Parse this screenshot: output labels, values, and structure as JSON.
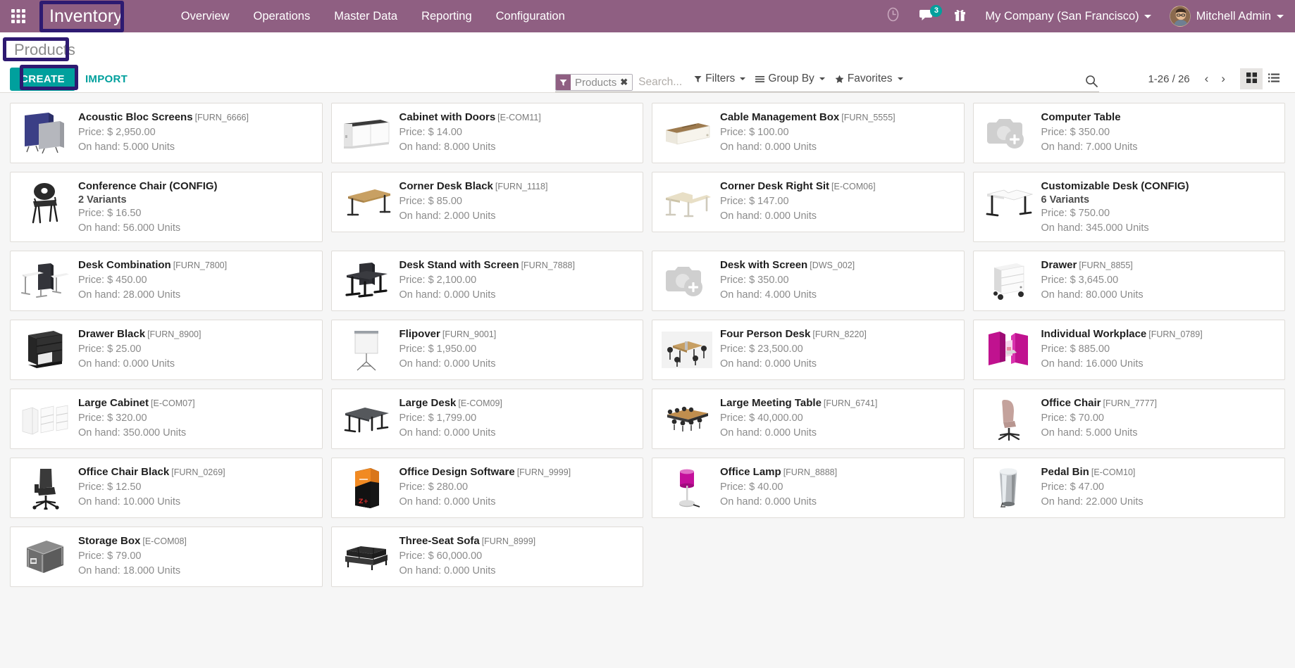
{
  "navbar": {
    "apps_icon": "apps-grid-icon",
    "brand": "Inventory",
    "menu": [
      {
        "label": "Overview"
      },
      {
        "label": "Operations"
      },
      {
        "label": "Master Data"
      },
      {
        "label": "Reporting"
      },
      {
        "label": "Configuration"
      }
    ],
    "activity_icon": "clock-icon",
    "messages_icon": "messages-icon",
    "messages_count": "3",
    "gift_icon": "gift-icon",
    "company": "My Company (San Francisco)",
    "user": "Mitchell Admin"
  },
  "control_panel": {
    "breadcrumb": "Products",
    "create_label": "CREATE",
    "import_label": "IMPORT",
    "filters_label": "Filters",
    "group_by_label": "Group By",
    "favorites_label": "Favorites",
    "pager": "1-26 / 26",
    "prev_icon": "chevron-left-icon",
    "next_icon": "chevron-right-icon",
    "kanban_view_icon": "kanban-view-icon",
    "list_view_icon": "list-view-icon"
  },
  "search": {
    "facet_label": "Products",
    "facet_remove_icon": "close-icon",
    "placeholder": "Search...",
    "value": "",
    "toggle_icon": "search-icon"
  },
  "highlights": {
    "color": "#2e1a71",
    "targets": [
      "brand-inventory",
      "breadcrumb-products",
      "create-button"
    ]
  },
  "colors": {
    "navbar": "#8f5f82",
    "accent": "#00a09d",
    "badge": "#00a09d",
    "highlight": "#2e1a71",
    "page_bg": "#f6f6f6"
  },
  "products": [
    {
      "name": "Acoustic Bloc Screens",
      "code": "[FURN_6666]",
      "variants": "",
      "price": "Price: $ 2,950.00",
      "on_hand": "On hand: 5.000 Units",
      "img": "acoustic-screens"
    },
    {
      "name": "Cabinet with Doors",
      "code": "[E-COM11]",
      "variants": "",
      "price": "Price: $ 14.00",
      "on_hand": "On hand: 8.000 Units",
      "img": "cabinet-doors"
    },
    {
      "name": "Cable Management Box",
      "code": "[FURN_5555]",
      "variants": "",
      "price": "Price: $ 100.00",
      "on_hand": "On hand: 0.000 Units",
      "img": "cable-box"
    },
    {
      "name": "Computer Table",
      "code": "",
      "variants": "",
      "price": "Price: $ 350.00",
      "on_hand": "On hand: 7.000 Units",
      "img": "placeholder"
    },
    {
      "name": "Conference Chair (CONFIG)",
      "code": "",
      "variants": "2 Variants",
      "price": "Price: $ 16.50",
      "on_hand": "On hand: 56.000 Units",
      "img": "conference-chair"
    },
    {
      "name": "Corner Desk Black",
      "code": "[FURN_1118]",
      "variants": "",
      "price": "Price: $ 85.00",
      "on_hand": "On hand: 2.000 Units",
      "img": "corner-desk-black"
    },
    {
      "name": "Corner Desk Right Sit",
      "code": "[E-COM06]",
      "variants": "",
      "price": "Price: $ 147.00",
      "on_hand": "On hand: 0.000 Units",
      "img": "corner-desk-right"
    },
    {
      "name": "Customizable Desk (CONFIG)",
      "code": "",
      "variants": "6 Variants",
      "price": "Price: $ 750.00",
      "on_hand": "On hand: 345.000 Units",
      "img": "customizable-desk"
    },
    {
      "name": "Desk Combination",
      "code": "[FURN_7800]",
      "variants": "",
      "price": "Price: $ 450.00",
      "on_hand": "On hand: 28.000 Units",
      "img": "desk-combination"
    },
    {
      "name": "Desk Stand with Screen",
      "code": "[FURN_7888]",
      "variants": "",
      "price": "Price: $ 2,100.00",
      "on_hand": "On hand: 0.000 Units",
      "img": "desk-stand-screen"
    },
    {
      "name": "Desk with Screen",
      "code": "[DWS_002]",
      "variants": "",
      "price": "Price: $ 350.00",
      "on_hand": "On hand: 4.000 Units",
      "img": "placeholder"
    },
    {
      "name": "Drawer",
      "code": "[FURN_8855]",
      "variants": "",
      "price": "Price: $ 3,645.00",
      "on_hand": "On hand: 80.000 Units",
      "img": "drawer-white"
    },
    {
      "name": "Drawer Black",
      "code": "[FURN_8900]",
      "variants": "",
      "price": "Price: $ 25.00",
      "on_hand": "On hand: 0.000 Units",
      "img": "drawer-black"
    },
    {
      "name": "Flipover",
      "code": "[FURN_9001]",
      "variants": "",
      "price": "Price: $ 1,950.00",
      "on_hand": "On hand: 0.000 Units",
      "img": "flipover"
    },
    {
      "name": "Four Person Desk",
      "code": "[FURN_8220]",
      "variants": "",
      "price": "Price: $ 23,500.00",
      "on_hand": "On hand: 0.000 Units",
      "img": "four-person-desk"
    },
    {
      "name": "Individual Workplace",
      "code": "[FURN_0789]",
      "variants": "",
      "price": "Price: $ 885.00",
      "on_hand": "On hand: 16.000 Units",
      "img": "individual-workplace"
    },
    {
      "name": "Large Cabinet",
      "code": "[E-COM07]",
      "variants": "",
      "price": "Price: $ 320.00",
      "on_hand": "On hand: 350.000 Units",
      "img": "large-cabinet"
    },
    {
      "name": "Large Desk",
      "code": "[E-COM09]",
      "variants": "",
      "price": "Price: $ 1,799.00",
      "on_hand": "On hand: 0.000 Units",
      "img": "large-desk"
    },
    {
      "name": "Large Meeting Table",
      "code": "[FURN_6741]",
      "variants": "",
      "price": "Price: $ 40,000.00",
      "on_hand": "On hand: 0.000 Units",
      "img": "meeting-table"
    },
    {
      "name": "Office Chair",
      "code": "[FURN_7777]",
      "variants": "",
      "price": "Price: $ 70.00",
      "on_hand": "On hand: 5.000 Units",
      "img": "office-chair-pink"
    },
    {
      "name": "Office Chair Black",
      "code": "[FURN_0269]",
      "variants": "",
      "price": "Price: $ 12.50",
      "on_hand": "On hand: 10.000 Units",
      "img": "office-chair-black"
    },
    {
      "name": "Office Design Software",
      "code": "[FURN_9999]",
      "variants": "",
      "price": "Price: $ 280.00",
      "on_hand": "On hand: 0.000 Units",
      "img": "software-box"
    },
    {
      "name": "Office Lamp",
      "code": "[FURN_8888]",
      "variants": "",
      "price": "Price: $ 40.00",
      "on_hand": "On hand: 0.000 Units",
      "img": "office-lamp"
    },
    {
      "name": "Pedal Bin",
      "code": "[E-COM10]",
      "variants": "",
      "price": "Price: $ 47.00",
      "on_hand": "On hand: 22.000 Units",
      "img": "pedal-bin"
    },
    {
      "name": "Storage Box",
      "code": "[E-COM08]",
      "variants": "",
      "price": "Price: $ 79.00",
      "on_hand": "On hand: 18.000 Units",
      "img": "storage-box"
    },
    {
      "name": "Three-Seat Sofa",
      "code": "[FURN_8999]",
      "variants": "",
      "price": "Price: $ 60,000.00",
      "on_hand": "On hand: 0.000 Units",
      "img": "sofa"
    }
  ]
}
